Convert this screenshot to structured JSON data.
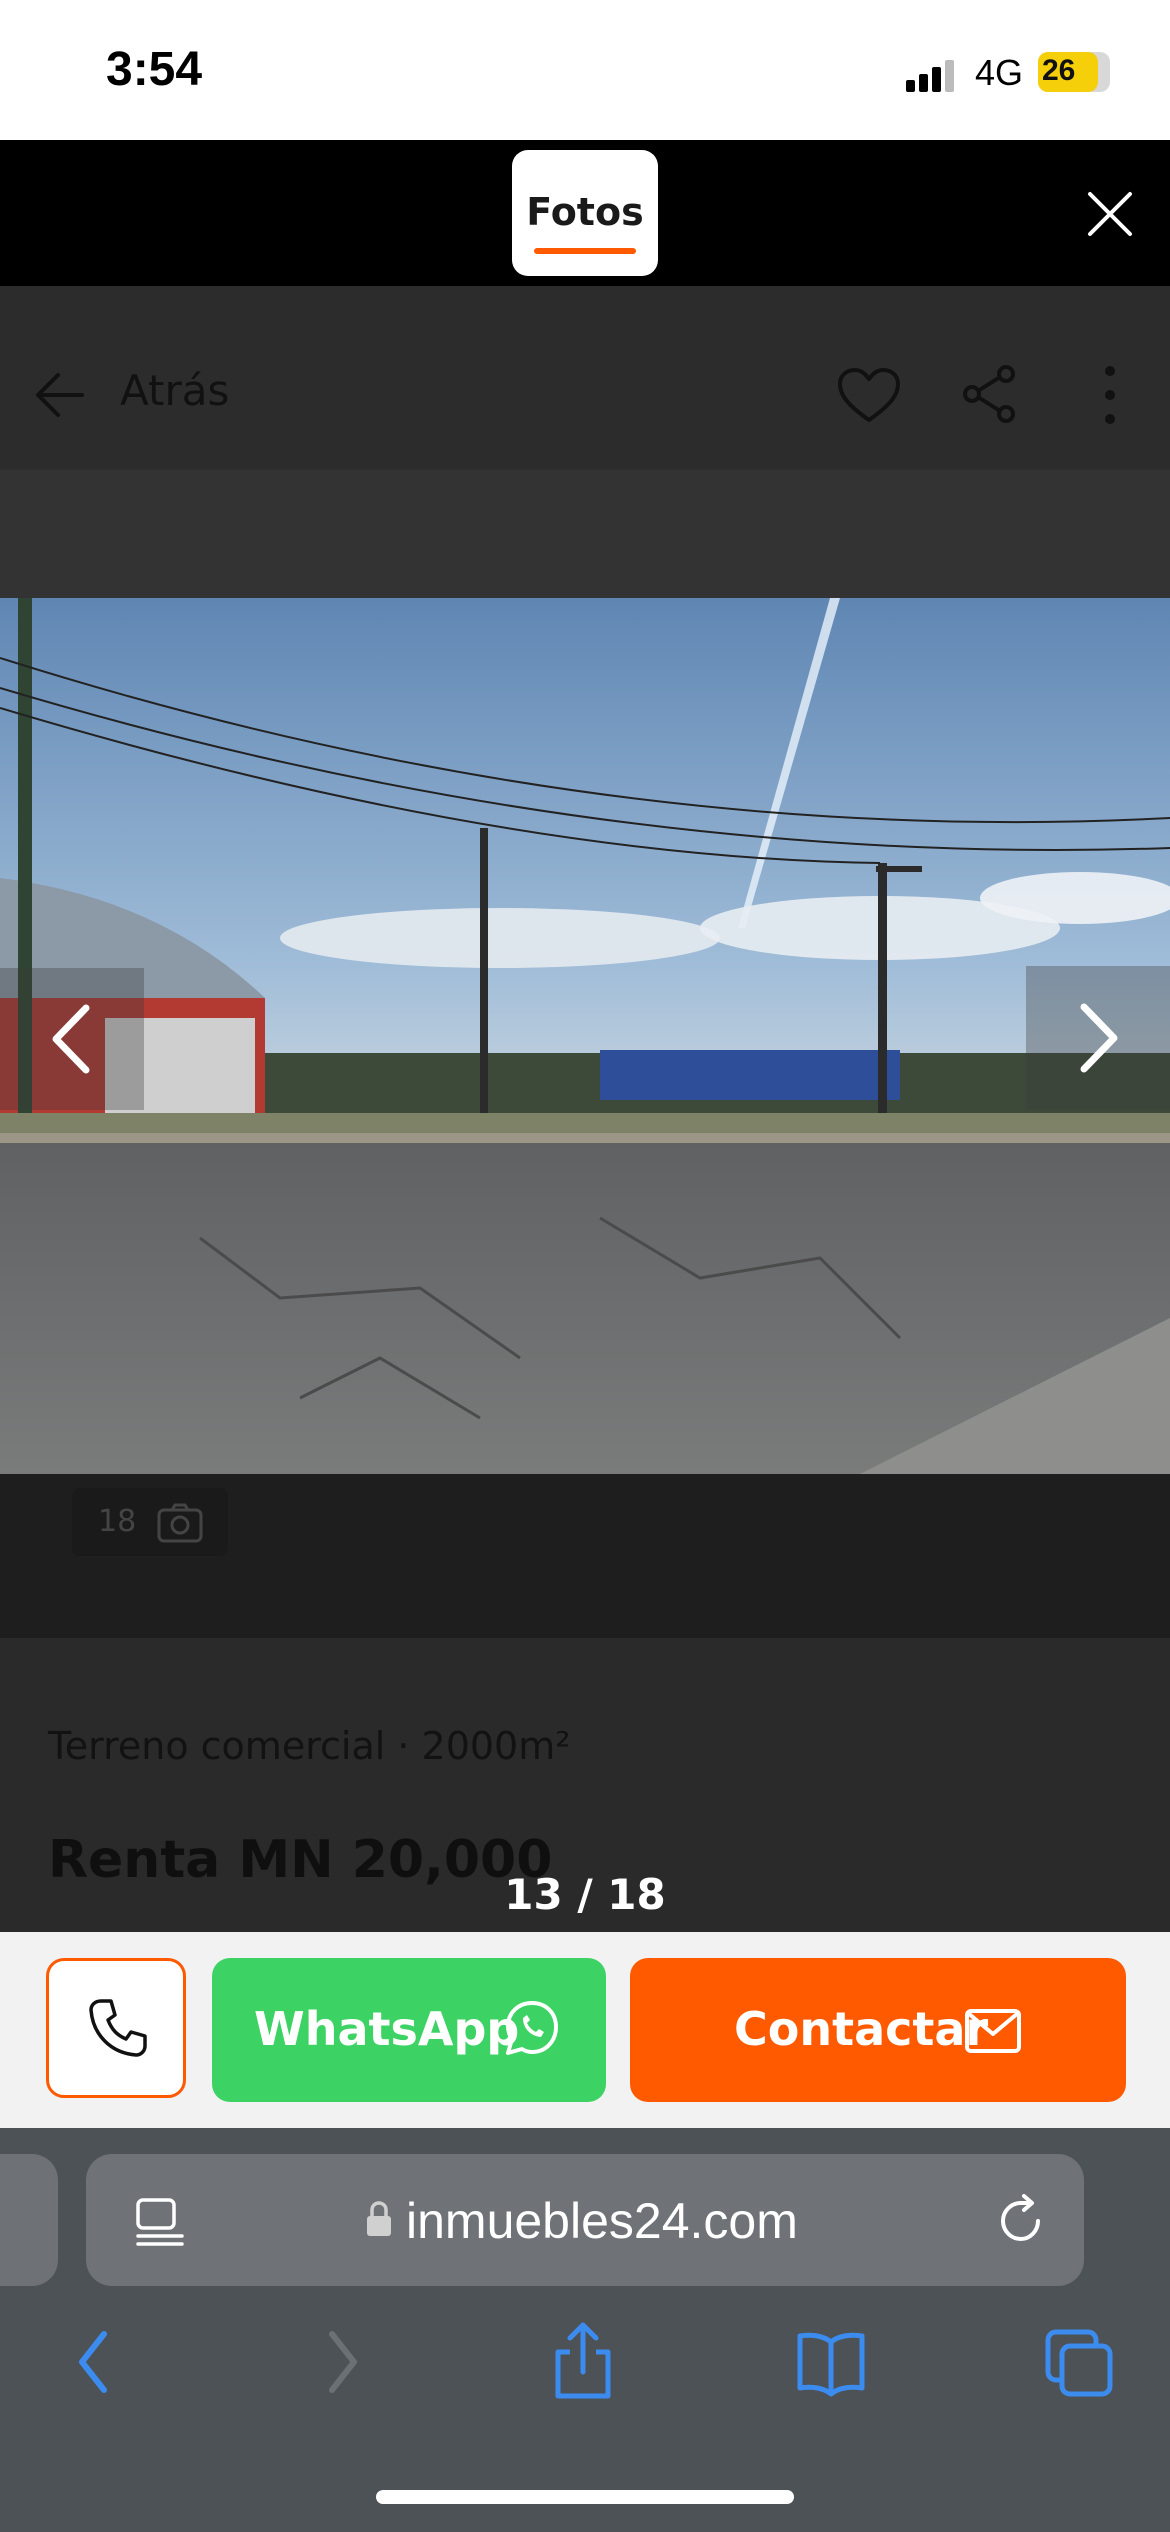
{
  "status_bar": {
    "time": "3:54",
    "network": "4G",
    "battery": "26"
  },
  "photo_header": {
    "tab_label": "Fotos"
  },
  "page_nav": {
    "back_label": "Atrás"
  },
  "gallery": {
    "photo_count": "18",
    "counter": "13 / 18"
  },
  "listing": {
    "property_type": "Terreno comercial · 2000m²",
    "price": "Renta MN 20,000"
  },
  "actions": {
    "whatsapp_label": "WhatsApp",
    "contact_label": "Contactar"
  },
  "browser": {
    "url": "inmuebles24.com"
  },
  "colors": {
    "accent": "#ff5a00",
    "whatsapp": "#3cd264",
    "safari_bar": "#4d5257"
  }
}
